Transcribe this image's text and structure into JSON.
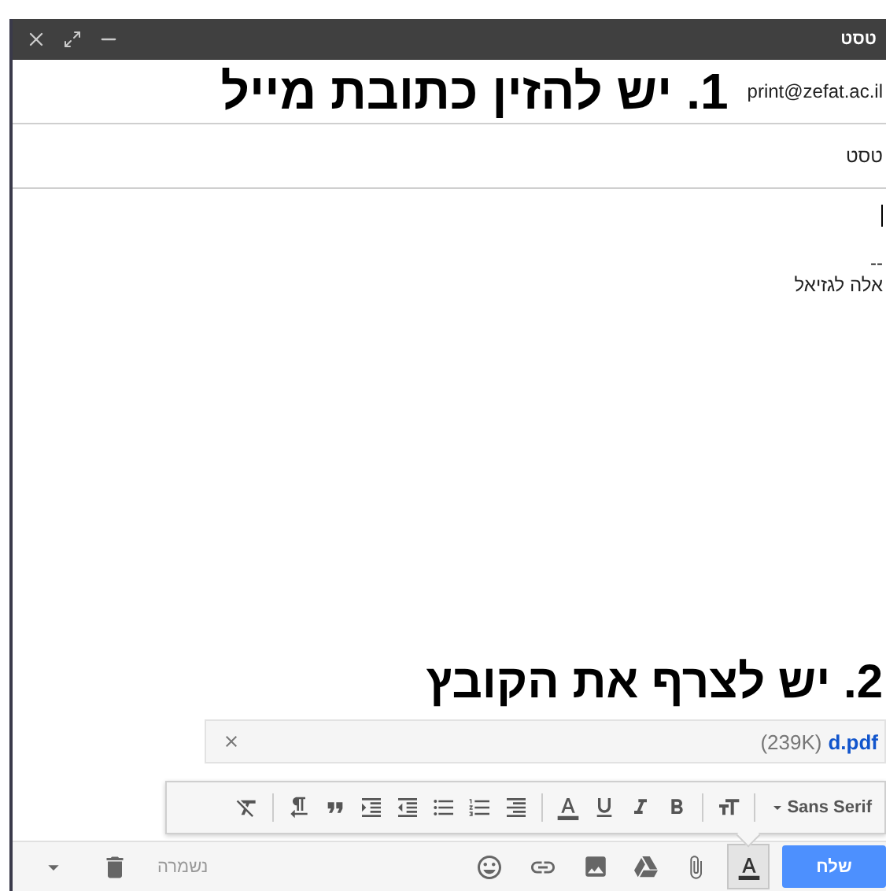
{
  "window": {
    "title": "טסט"
  },
  "recipients": {
    "value": "print@zefat.ac.il"
  },
  "annotations": [
    {
      "text": "1. יש להזין כתובת מייל"
    },
    {
      "text": "2. יש לצרף את הקובץ"
    }
  ],
  "subject": {
    "value": "טסט"
  },
  "body": {
    "lines": [
      "--",
      "אלה לגזיאל"
    ]
  },
  "attachment": {
    "name": "d.pdf",
    "size": "(239K)"
  },
  "toolbar": {
    "font": "Sans Serif"
  },
  "bottom_bar": {
    "send": "שלח",
    "formatting_selected": true,
    "status": "נשמרה"
  }
}
